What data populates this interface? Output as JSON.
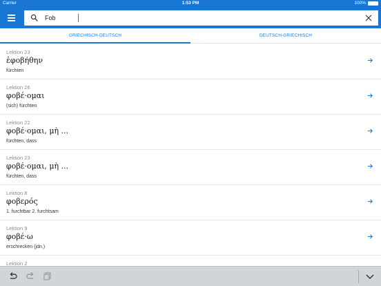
{
  "status_bar": {
    "carrier": "Carrier",
    "time": "1:53 PM",
    "battery": "100%"
  },
  "search": {
    "value": "Fob"
  },
  "tabs": [
    {
      "label": "GRIECHISCH-DEUTSCH",
      "active": true
    },
    {
      "label": "DEUTSCH-GRIECHISCH",
      "active": false
    }
  ],
  "entries": [
    {
      "lesson": "Lektion 23",
      "greek": "ἐφοβήθην",
      "german": "fürchten"
    },
    {
      "lesson": "Lektion 26",
      "greek": "φοβέ·ομαι",
      "german": "(sich) fürchten"
    },
    {
      "lesson": "Lektion 22",
      "greek": "φοβέ·ομαι, μὴ ...",
      "german": "fürchten, dass"
    },
    {
      "lesson": "Lektion 23",
      "greek": "φοβέ·ομαι, μὴ ...",
      "german": "fürchten, dass"
    },
    {
      "lesson": "Lektion 8",
      "greek": "φοβερός",
      "german": "1. furchtbar 2. furchtsam"
    },
    {
      "lesson": "Lektion 9",
      "greek": "φοβέ·ω",
      "german": "erschrecken (jdn.)"
    },
    {
      "lesson": "Lektion 2",
      "greek": "",
      "german": ""
    }
  ],
  "colors": {
    "accent": "#1976d2",
    "keyboard_bar": "#d1d4d9"
  },
  "icons": {
    "menu": "hamburger-icon",
    "search": "search-icon",
    "clear": "close-icon",
    "row_action": "arrow-right-icon",
    "undo": "undo-icon",
    "redo": "redo-icon",
    "paste": "paste-icon",
    "dismiss": "chevron-down-icon"
  }
}
